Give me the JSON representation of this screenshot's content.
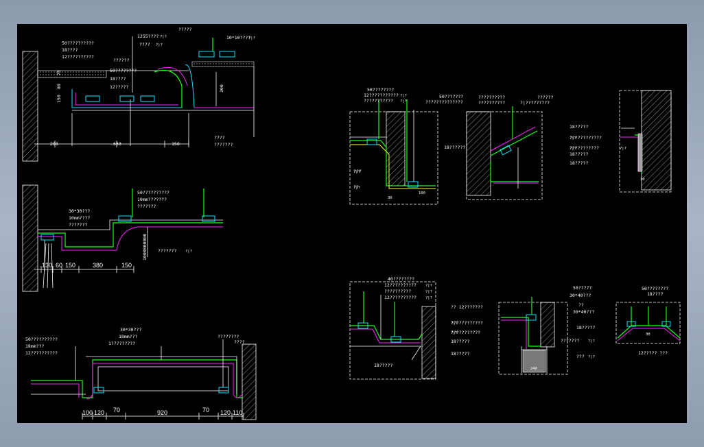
{
  "viewer": {
    "background": "#000000",
    "frame_color": "#9aa8bb"
  },
  "colors": {
    "white": "#ffffff",
    "green": "#19ff19",
    "cyan": "#19e0ff",
    "magenta": "#ff22ff",
    "yellow": "#ffff22",
    "red": "#ff3333"
  },
  "detail_a": {
    "labels": [
      "50??????????",
      "18????",
      "12??????????",
      "1255????",
      "??????",
      "????",
      "50????????",
      "18????",
      "12?????",
      "?????",
      "10*10????",
      "????",
      "???????"
    ],
    "tags": [
      "?|?",
      "?|?",
      "?|?"
    ],
    "dims": [
      "200",
      "630",
      "150",
      "300",
      "150",
      "80",
      "75"
    ]
  },
  "detail_b": {
    "labels": [
      "50??????????",
      "10mm???????",
      "???????",
      "30*30???",
      "10mm????",
      "???????",
      "???????"
    ],
    "tag": "?|?",
    "dims": [
      "130",
      "60",
      "150",
      "380",
      "150"
    ]
  },
  "detail_c": {
    "labels": [
      "50??????????",
      "18mm???",
      "12??????????",
      "30*30???",
      "18mm???",
      "1?????????",
      "????????",
      "????"
    ],
    "dims": [
      "100",
      "120",
      "70",
      "920",
      "70",
      "120",
      "110"
    ]
  },
  "detail_d": {
    "labels": [
      "50????????",
      "12???????????",
      "???????????",
      "???",
      "??",
      "18?????????",
      "50???????",
      "??????????????"
    ],
    "tags": [
      "?|?",
      "?|?",
      "?|?",
      "?|?"
    ],
    "dims": [
      "30",
      "100"
    ]
  },
  "detail_e": {
    "labels": [
      "18??????",
      "??????????",
      "??????????",
      "??????",
      "?|?????????",
      "???????????"
    ]
  },
  "detail_f": {
    "labels": [
      "18?????",
      "????????????",
      "???????????",
      "18?????",
      "18?????"
    ],
    "tags": [
      "?|?",
      "?|?",
      "?|?"
    ],
    "dims": [
      "30"
    ]
  },
  "detail_g": {
    "labels": [
      "40????????",
      "12??????????",
      "??????????",
      "12??????????",
      "18?????"
    ],
    "tags": [
      "?|?",
      "?|?",
      "?|?"
    ]
  },
  "detail_h": {
    "labels": [
      "50?????",
      "30*40???",
      "??",
      "30*40???",
      "18?????",
      "???????",
      "???",
      "?? 12???????",
      "????????????",
      "???????????",
      "18?????",
      "18?????"
    ],
    "tags": [
      "?|?",
      "?|?",
      "?|?",
      "?|?"
    ],
    "dims": [
      "240"
    ]
  },
  "detail_i": {
    "labels": [
      "50????????",
      "18????",
      "12????? ???"
    ],
    "dims": [
      "30"
    ]
  }
}
